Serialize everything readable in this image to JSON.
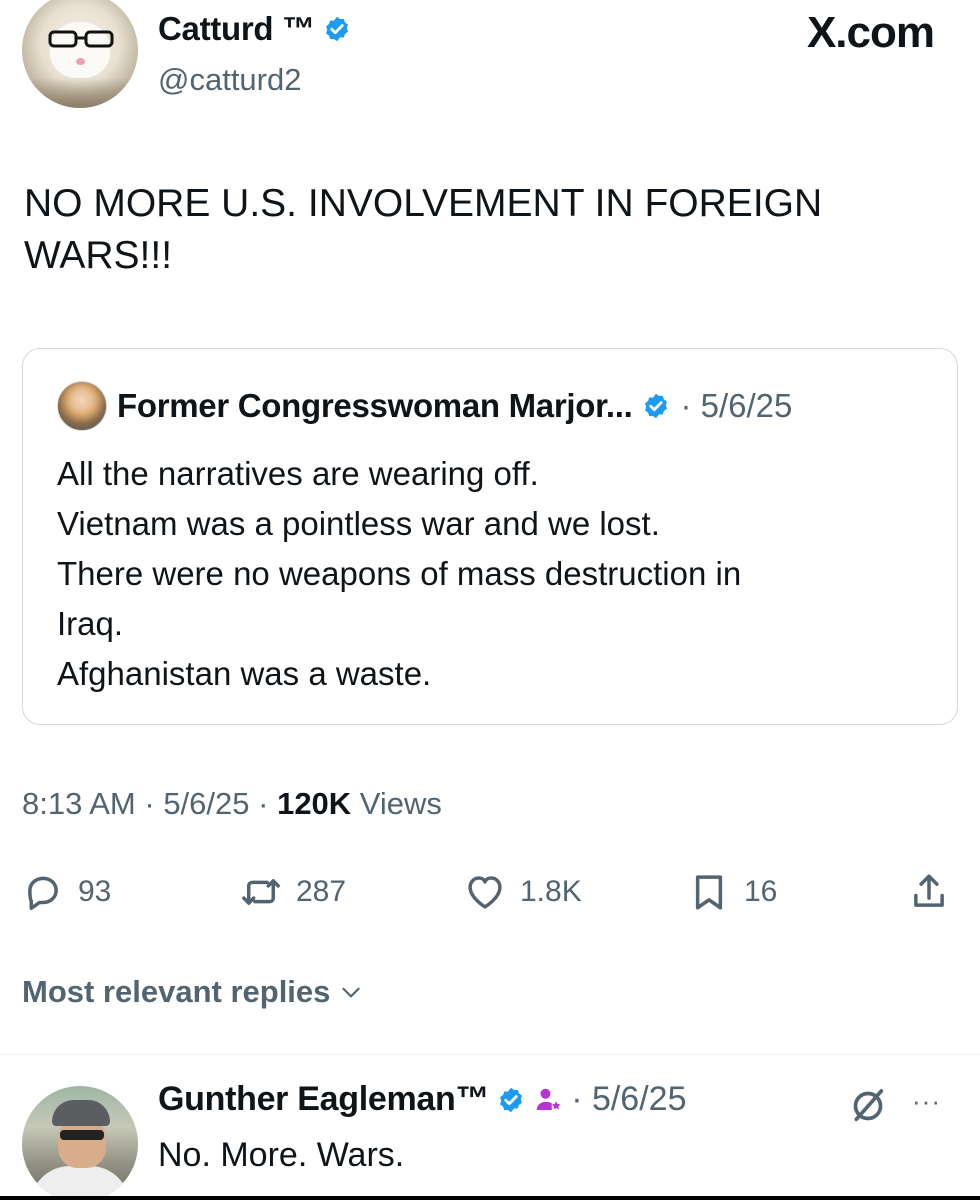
{
  "header": {
    "author_name": "Catturd ™",
    "author_handle": "@catturd2",
    "site_brand": "X.com",
    "verified_icon": "verified-badge-icon"
  },
  "post": {
    "text": "NO MORE U.S. INVOLVEMENT IN FOREIGN WARS!!!"
  },
  "quote": {
    "author_name": "Former Congresswoman Marjor...",
    "date": "· 5/6/25",
    "lines": [
      "All the narratives are wearing off.",
      "Vietnam was a pointless war and we lost.",
      "There were no weapons of mass destruction in",
      "Iraq.",
      "Afghanistan was a waste."
    ]
  },
  "meta": {
    "time": "8:13 AM",
    "sep1": " · ",
    "date": "5/6/25",
    "sep2": " · ",
    "views_count": "120K",
    "views_label": " Views"
  },
  "actions": {
    "replies": "93",
    "reposts": "287",
    "likes": "1.8K",
    "bookmarks": "16"
  },
  "replies_sort": {
    "label": "Most relevant replies"
  },
  "reply": {
    "author_name": "Gunther Eagleman™",
    "date": "· 5/6/25",
    "text": "No. More. Wars.",
    "more": "···"
  },
  "colors": {
    "text_primary": "#0f1419",
    "text_secondary": "#536471",
    "verified_blue": "#1d9bf0",
    "border": "#cfd9de",
    "affiliate_purple": "#b833d4"
  }
}
